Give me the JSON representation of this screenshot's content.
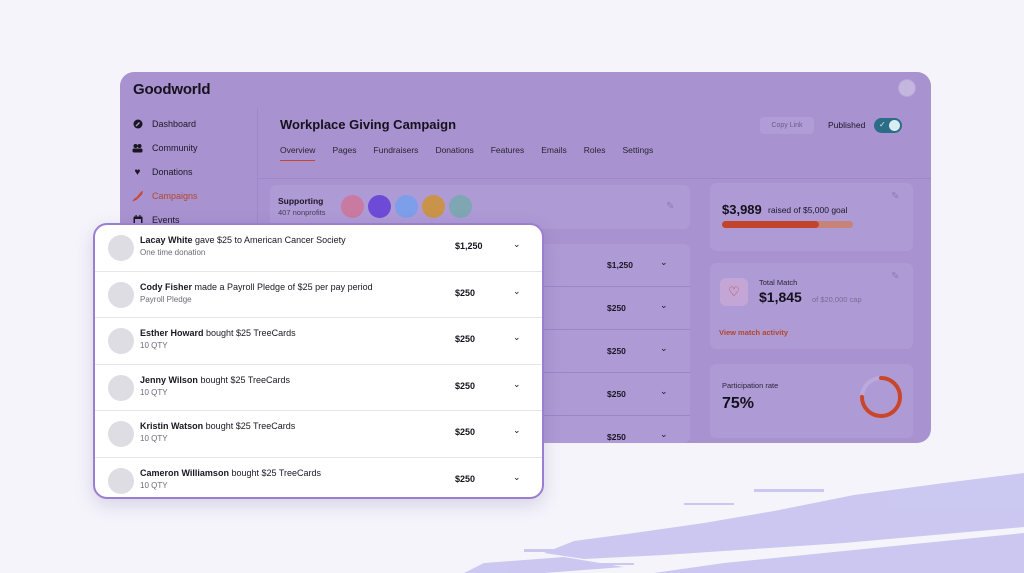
{
  "app": {
    "logo": "Goodworld"
  },
  "sidebar": {
    "items": [
      {
        "label": "Dashboard",
        "icon": "dashboard-icon"
      },
      {
        "label": "Community",
        "icon": "community-icon"
      },
      {
        "label": "Donations",
        "icon": "heart-icon"
      },
      {
        "label": "Campaigns",
        "icon": "campaign-icon",
        "active": true
      },
      {
        "label": "Events",
        "icon": "calendar-icon"
      }
    ]
  },
  "header": {
    "title": "Workplace Giving Campaign",
    "copy_link": "Copy Link",
    "published_label": "Published",
    "published": true
  },
  "tabs": [
    {
      "label": "Overview",
      "active": true
    },
    {
      "label": "Pages"
    },
    {
      "label": "Fundraisers"
    },
    {
      "label": "Donations"
    },
    {
      "label": "Features"
    },
    {
      "label": "Emails"
    },
    {
      "label": "Roles"
    },
    {
      "label": "Settings"
    }
  ],
  "supporting": {
    "title": "Supporting",
    "subtitle": "407 nonprofits",
    "avatar_colors": [
      "#c97aa0",
      "#6e4bd6",
      "#7d9ee8",
      "#c9944a",
      "#7fa6b3"
    ]
  },
  "background_donations": [
    "$1,250",
    "$250",
    "$250",
    "$250",
    "$250"
  ],
  "raised": {
    "amount": "$3,989",
    "subtitle": "raised of $5,000 goal",
    "progress": 0.74
  },
  "match": {
    "label": "Total Match",
    "amount": "$1,845",
    "cap": "of $20,000 cap",
    "link": "View match activity"
  },
  "participation": {
    "label": "Participation rate",
    "value": "75%",
    "rate": 0.75
  },
  "popup": {
    "rows": [
      {
        "name": "Lacay White",
        "action": " gave $25 to American Cancer Society",
        "detail": "One time donation",
        "amount": "$1,250"
      },
      {
        "name": "Cody Fisher",
        "action": " made a Payroll Pledge of $25 per pay period",
        "detail": "Payroll Pledge",
        "amount": "$250"
      },
      {
        "name": "Esther Howard",
        "action": " bought $25 TreeCards",
        "detail": "10 QTY",
        "amount": "$250"
      },
      {
        "name": "Jenny Wilson",
        "action": " bought $25 TreeCards",
        "detail": "10 QTY",
        "amount": "$250"
      },
      {
        "name": "Kristin Watson",
        "action": " bought $25 TreeCards",
        "detail": "10 QTY",
        "amount": "$250"
      },
      {
        "name": "Cameron Williamson",
        "action": " bought $25 TreeCards",
        "detail": "10 QTY",
        "amount": "$250"
      }
    ]
  },
  "colors": {
    "overlay": "#a892cf",
    "accent": "#c9462b",
    "popup_border": "#9c7ed0"
  }
}
